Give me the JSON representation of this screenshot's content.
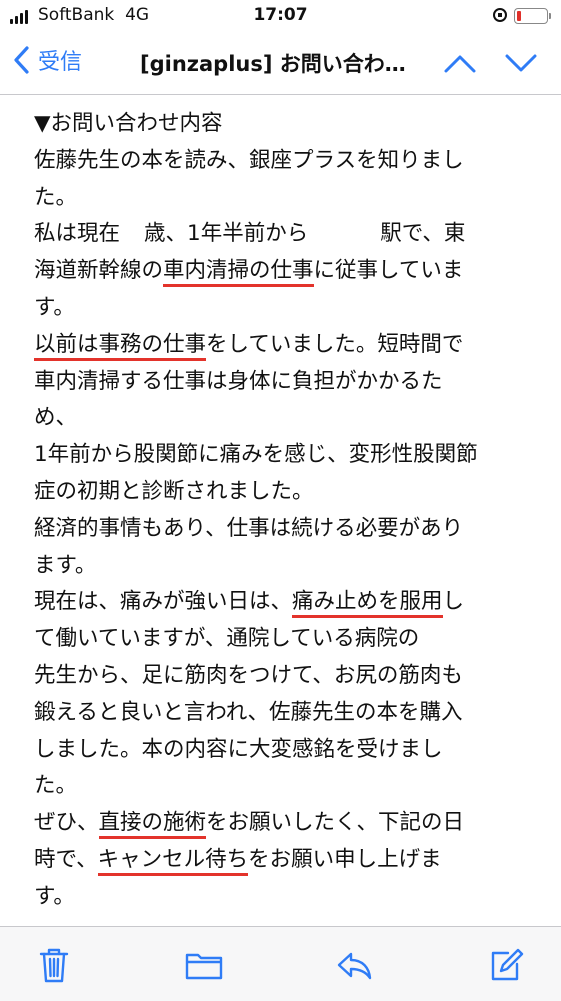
{
  "status_bar": {
    "carrier": "SoftBank",
    "network": "4G",
    "time": "17:07",
    "battery_color": "#e0302a"
  },
  "nav": {
    "back_label": "受信",
    "subject": "[ginzaplus] お問い合わ…",
    "accent_color": "#2f7cf6"
  },
  "mail": {
    "lines": [
      "▼お問い合わせ内容",
      "佐藤先生の本を読み、銀座プラスを知りまし",
      "た。",
      {
        "a": "私は現在",
        "b": "歳、1年半前から",
        "c": "駅で、東"
      },
      {
        "pre": "海道新幹線の",
        "u": "車内清掃の仕事",
        "post": "に従事していま"
      },
      "す。",
      {
        "pre": "",
        "u": "以前は事務の仕事",
        "post": "をしていました。短時間で"
      },
      "車内清掃する仕事は身体に負担がかかるた",
      "め、",
      "1年前から股関節に痛みを感じ、変形性股関節",
      "症の初期と診断されました。",
      "経済的事情もあり、仕事は続ける必要があり",
      "ます。",
      {
        "pre": "現在は、痛みが強い日は、",
        "u": "痛み止めを服用",
        "post": "し"
      },
      "て働いていますが、通院している病院の",
      "先生から、足に筋肉をつけて、お尻の筋肉も",
      "鍛えると良いと言われ、佐藤先生の本を購入",
      "しました。本の内容に大変感銘を受けまし",
      "た。",
      {
        "pre": "ぜひ、",
        "u": "直接の施術",
        "post": "をお願いしたく、下記の日"
      },
      {
        "pre": "時で、",
        "u": "キャンセル待ち",
        "post": "をお願い申し上げま"
      },
      "す。"
    ],
    "underline_color": "#e3332b"
  },
  "toolbar": {
    "icons": [
      "trash-icon",
      "folder-icon",
      "reply-icon",
      "compose-icon"
    ]
  }
}
